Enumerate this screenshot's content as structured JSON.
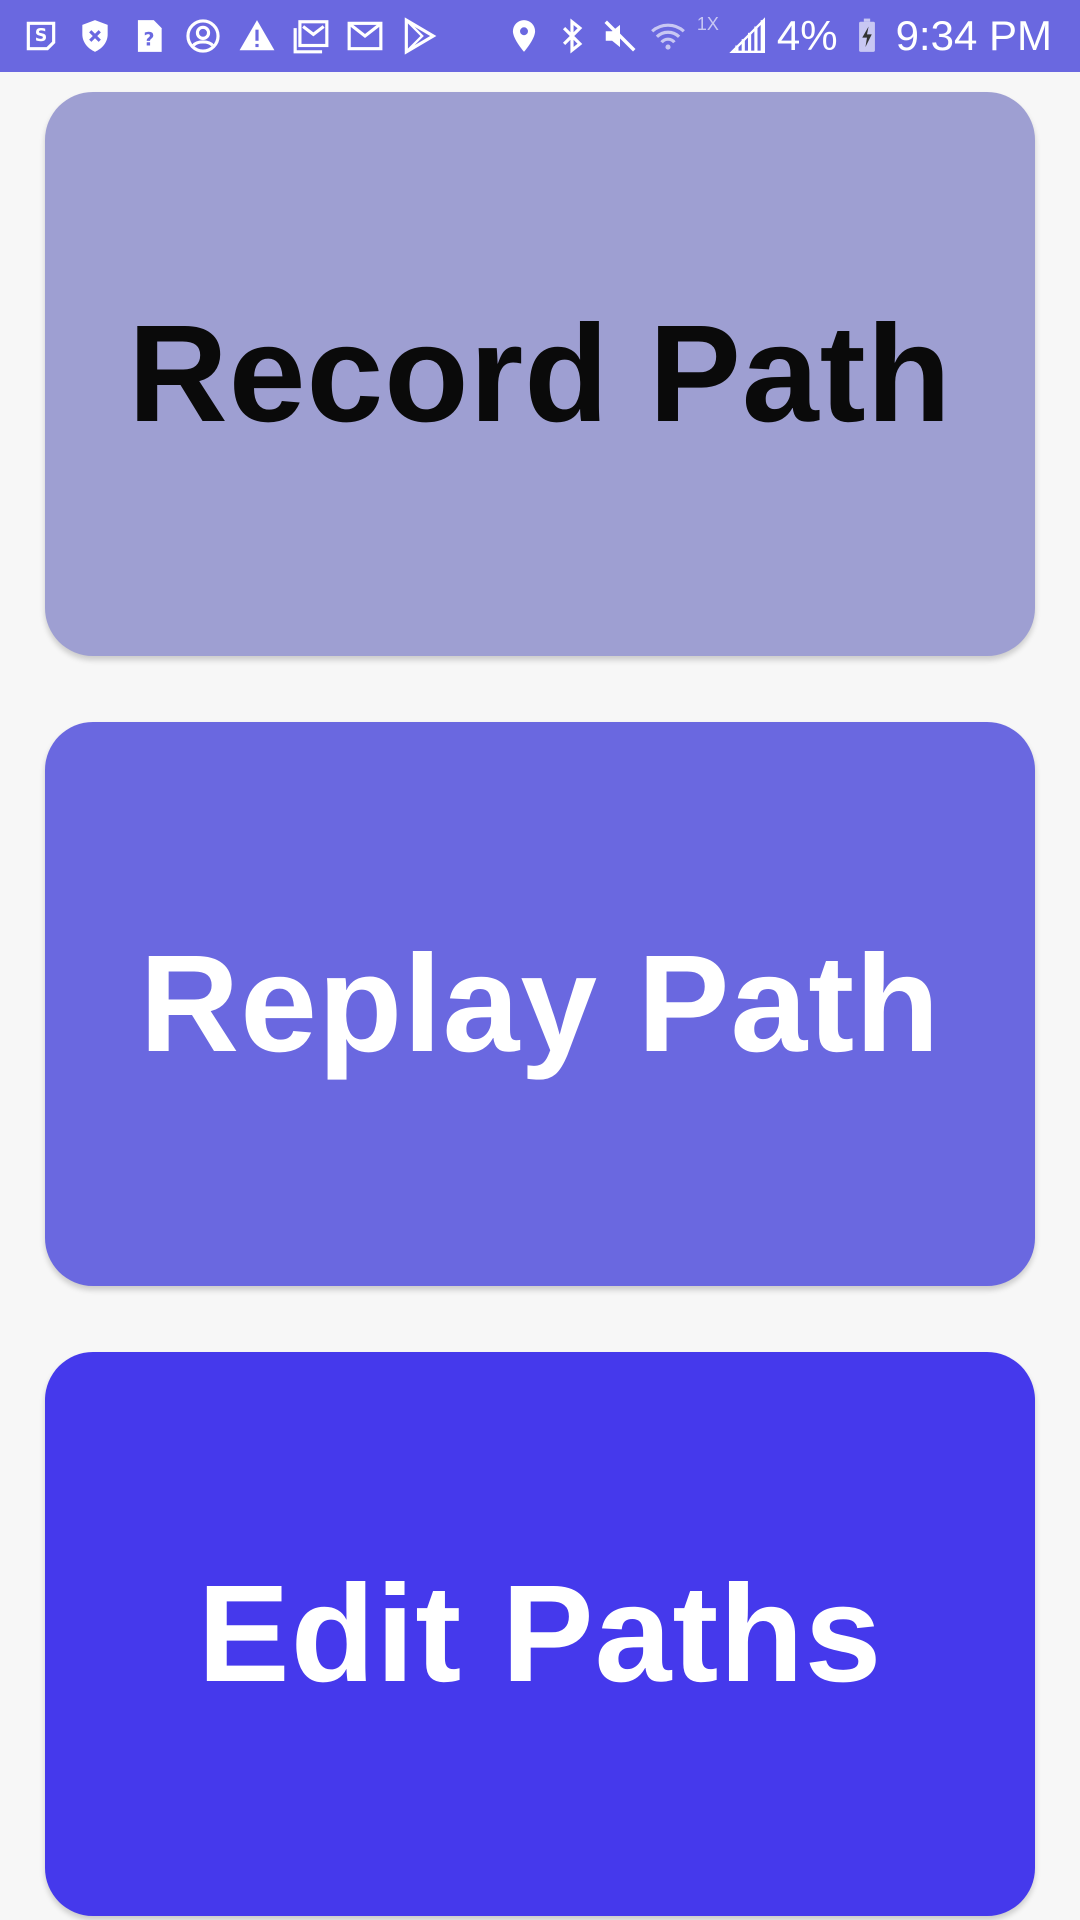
{
  "status_bar": {
    "bg_color": "#6a68e0",
    "left_icons": [
      "s-note-icon",
      "shield-x-icon",
      "help-doc-icon",
      "account-circle-icon",
      "warning-icon",
      "gallery-icon",
      "gmail-icon",
      "play-store-icon"
    ],
    "right_icons": [
      "location-pin-icon",
      "bluetooth-icon",
      "mute-icon",
      "wifi-icon",
      "signal-icon",
      "battery-charging-icon"
    ],
    "wifi_badge": "1X",
    "battery": "4%",
    "time": "9:34 PM"
  },
  "buttons": [
    {
      "label": "Record Path",
      "bg_color": "#9e9fd2",
      "text_color": "#0a0a0a"
    },
    {
      "label": "Replay Path",
      "bg_color": "#6a68e0",
      "text_color": "#ffffff"
    },
    {
      "label": "Edit Paths",
      "bg_color": "#4539ec",
      "text_color": "#ffffff"
    }
  ]
}
